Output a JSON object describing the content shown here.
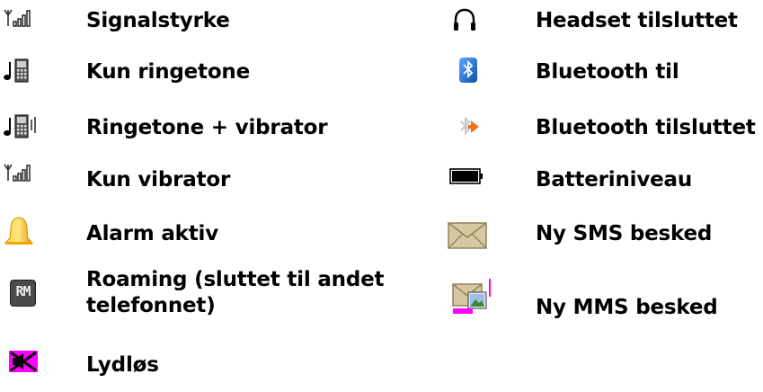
{
  "left": [
    {
      "label": "Signalstyrke",
      "icon": "signal-strength-icon"
    },
    {
      "label": "Kun ringetone",
      "icon": "ringtone-only-icon"
    },
    {
      "label": "Ringetone + vibrator",
      "icon": "ringtone-vibrator-icon"
    },
    {
      "label": "Kun vibrator",
      "icon": "vibrator-only-icon"
    },
    {
      "label": "Alarm aktiv",
      "icon": "alarm-bell-icon"
    },
    {
      "label": "Roaming (sluttet til andet telefonnet)",
      "icon": "roaming-icon"
    },
    {
      "label": "Lydløs",
      "icon": "silent-icon"
    }
  ],
  "right": [
    {
      "label": "Headset tilsluttet",
      "icon": "headset-icon"
    },
    {
      "label": "Bluetooth til",
      "icon": "bluetooth-on-icon"
    },
    {
      "label": "Bluetooth tilsluttet",
      "icon": "bluetooth-connected-icon"
    },
    {
      "label": "Batteriniveau",
      "icon": "battery-icon"
    },
    {
      "label": "Ny SMS besked",
      "icon": "sms-envelope-icon"
    },
    {
      "label": "Ny MMS besked",
      "icon": "mms-envelope-icon"
    }
  ],
  "roaming_icon_text": "RM",
  "colors": {
    "bell": "#f5b800",
    "bluetooth_blue": "#1e6fd0",
    "bluetooth_orange": "#f07020",
    "silent_magenta": "#ff00ff",
    "envelope_tan": "#d8c8a0",
    "mms_magenta": "#ff00ff"
  }
}
